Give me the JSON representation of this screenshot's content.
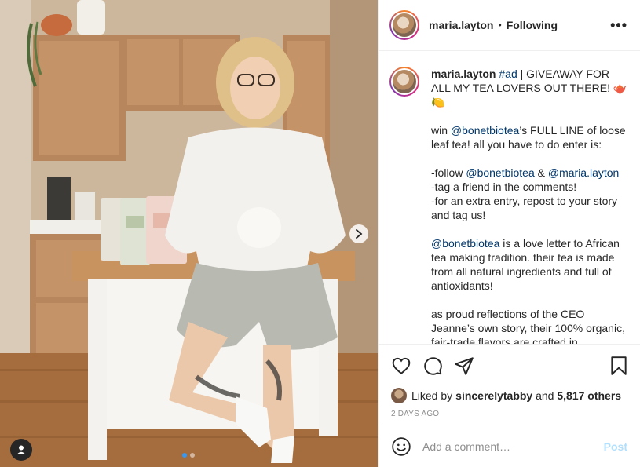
{
  "post": {
    "username": "maria.layton",
    "separator": "•",
    "follow_status": "Following",
    "more_icon": "more-options-icon",
    "more_label": "•••"
  },
  "media": {
    "carousel_total": 2,
    "carousel_active": 1,
    "next_icon": "chevron-right-icon",
    "user_tag_icon": "user-tag-icon"
  },
  "caption": {
    "username": "maria.layton",
    "hashtag": "#ad",
    "line1_rest": " | GIVEAWAY FOR ALL MY TEA LOVERS OUT THERE! 🫖🍋",
    "p2_pre": "win ",
    "p2_mention": "@bonetbiotea",
    "p2_post": "’s FULL LINE of loose leaf tea! all you have to do enter is:",
    "p3_a": "-follow ",
    "p3_mention1": "@bonetbiotea",
    "p3_amp": " & ",
    "p3_mention2": "@maria.layton",
    "p3_b": "-tag a friend in the comments!",
    "p3_c": "-for an extra entry, repost to your story and tag us!",
    "p4_mention": "@bonetbiotea",
    "p4_rest": " is a love letter to African tea making tradition. their tea is made from all natural ingredients and full of antioxidants!",
    "p5": "as proud reflections of the CEO Jeanne’s own story, their 100% organic, fair-trade flavors are crafted in"
  },
  "actions": {
    "like_icon": "heart-icon",
    "comment_icon": "comment-icon",
    "share_icon": "share-icon",
    "save_icon": "bookmark-icon"
  },
  "likes": {
    "prefix": "Liked by ",
    "user": "sincerelytabby",
    "middle": " and ",
    "others": "5,817 others"
  },
  "timestamp": "2 DAYS AGO",
  "comment_box": {
    "placeholder": "Add a comment…",
    "post_label": "Post",
    "emoji_icon": "emoji-icon"
  },
  "colors": {
    "link": "#00376b",
    "post_disabled": "#b2dffc",
    "muted": "#8e8e8e",
    "carousel_active": "#3897f0"
  }
}
